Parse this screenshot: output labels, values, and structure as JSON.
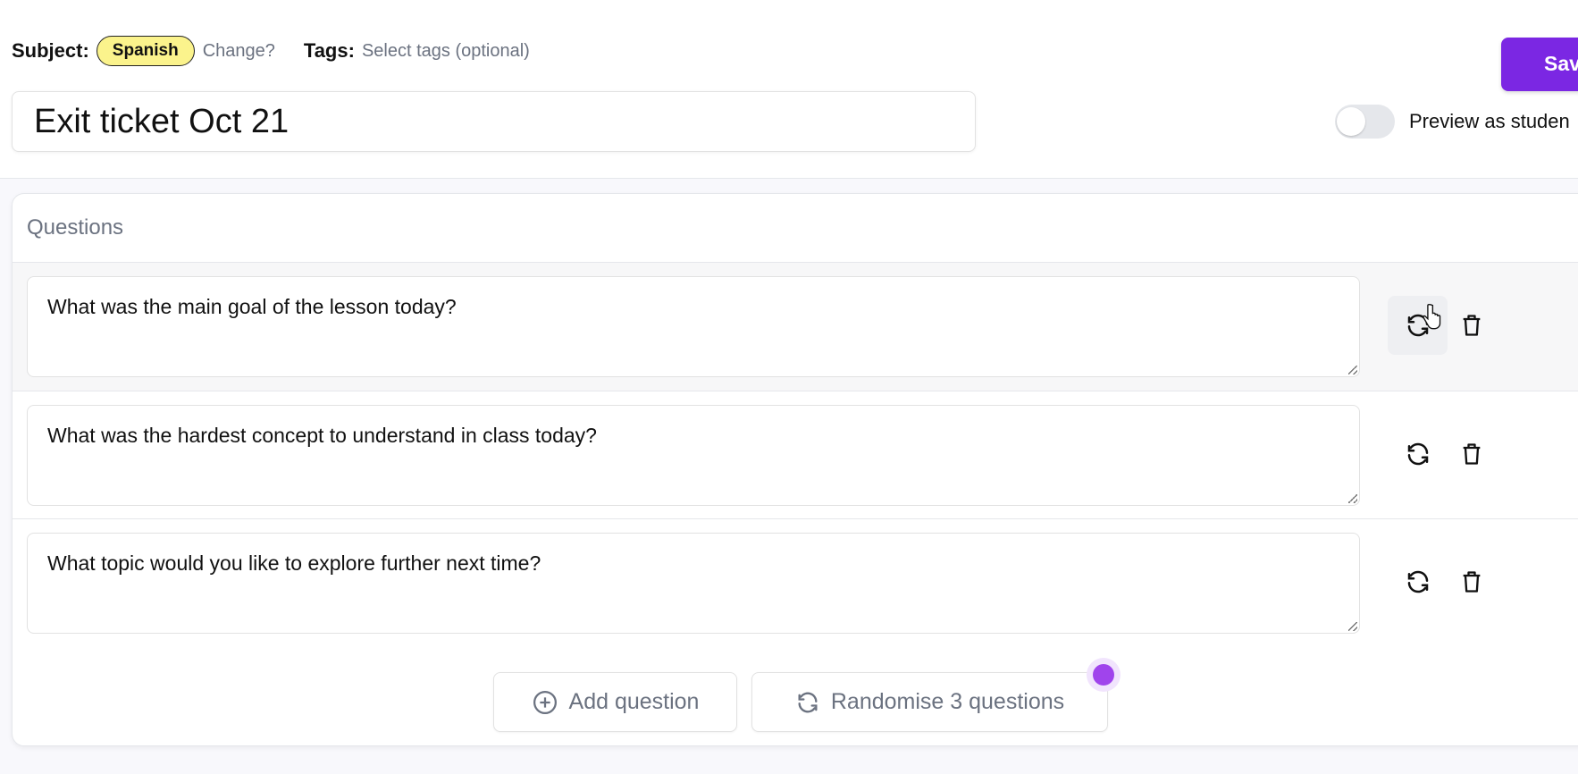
{
  "header": {
    "subject_label": "Subject:",
    "subject_value": "Spanish",
    "change_link": "Change?",
    "tags_label": "Tags:",
    "tags_placeholder": "Select tags (optional)",
    "title_value": "Exit ticket Oct 21",
    "save_label": "Save",
    "preview_label": "Preview as studen",
    "preview_on": false
  },
  "questions": {
    "heading": "Questions",
    "items": [
      {
        "text": "What was the main goal of the lesson today?"
      },
      {
        "text": "What was the hardest concept to understand in class today?"
      },
      {
        "text": "What topic would you like to explore further next time?"
      }
    ],
    "add_label": "Add question",
    "randomise_label": "Randomise 3 questions"
  },
  "colors": {
    "accent": "#7b27e3",
    "subject_pill": "#fbf38c",
    "notification_dot": "#a044ec"
  },
  "icons": [
    "refresh-icon",
    "trash-icon",
    "plus-circle-icon",
    "cursor-hand-icon"
  ]
}
